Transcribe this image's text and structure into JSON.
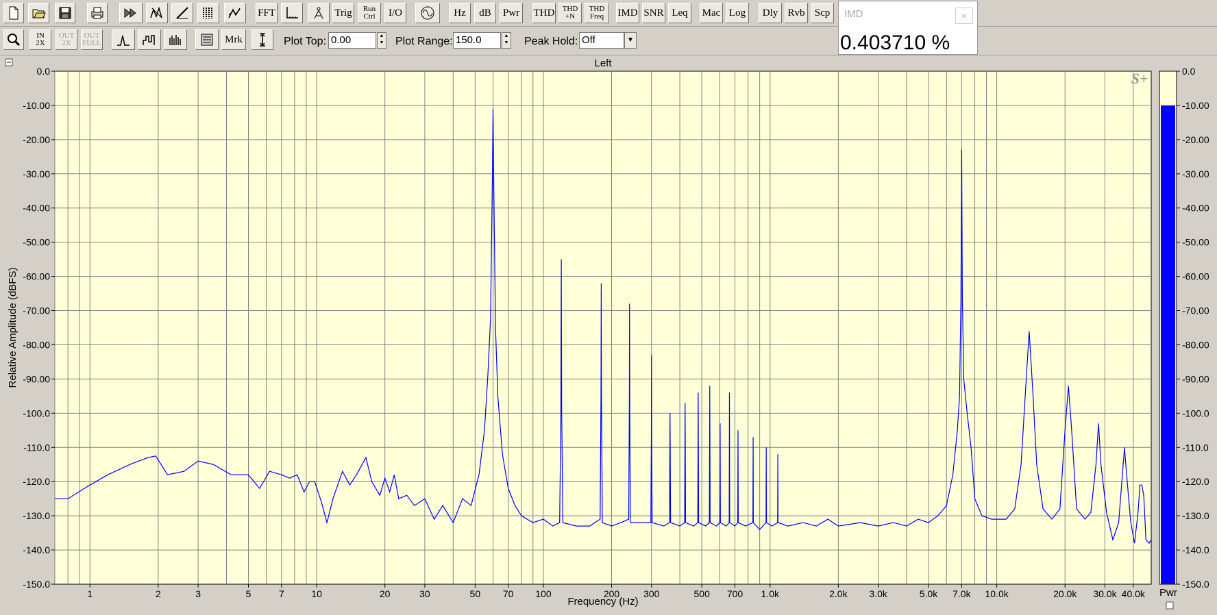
{
  "toolbar1": {
    "buttons": [
      {
        "name": "new-file-icon",
        "text": ""
      },
      {
        "name": "open-file-icon",
        "text": ""
      },
      {
        "name": "save-icon",
        "text": ""
      },
      {
        "name": "print-icon",
        "text": ""
      },
      {
        "name": "fast-forward-icon",
        "text": ""
      },
      {
        "name": "spectrum-settings-icon",
        "text": ""
      },
      {
        "name": "ramp-icon",
        "text": ""
      },
      {
        "name": "waterfall-icon",
        "text": ""
      },
      {
        "name": "3d-plot-icon",
        "text": ""
      },
      {
        "name": "fft-button",
        "text": "FFT"
      },
      {
        "name": "axis-button",
        "text": ""
      },
      {
        "name": "calibrate-icon",
        "text": ""
      },
      {
        "name": "trig-button",
        "text": "Trig"
      },
      {
        "name": "run-ctrl-button",
        "text": "Run\nCtrl"
      },
      {
        "name": "io-button",
        "text": "I/O"
      },
      {
        "name": "generator-icon",
        "text": ""
      },
      {
        "name": "hz-button",
        "text": "Hz"
      },
      {
        "name": "db-button",
        "text": "dB"
      },
      {
        "name": "pwr-button",
        "text": "Pwr"
      },
      {
        "name": "thd-button",
        "text": "THD"
      },
      {
        "name": "thd-n-button",
        "text": "THD\n+N"
      },
      {
        "name": "thd-freq-button",
        "text": "THD\nFreq"
      },
      {
        "name": "imd-button",
        "text": "IMD"
      },
      {
        "name": "snr-button",
        "text": "SNR"
      },
      {
        "name": "leq-button",
        "text": "Leq"
      },
      {
        "name": "mac-button",
        "text": "Mac"
      },
      {
        "name": "log-button",
        "text": "Log"
      },
      {
        "name": "dly-button",
        "text": "Dly"
      },
      {
        "name": "rvb-button",
        "text": "Rvb"
      },
      {
        "name": "scp-button",
        "text": "Scp"
      }
    ]
  },
  "toolbar2": {
    "buttons": [
      {
        "name": "zoom-icon",
        "text": ""
      },
      {
        "name": "zoom-in-2x-button",
        "text": "IN\n2X"
      },
      {
        "name": "zoom-out-2x-button",
        "text": "OUT\n2X"
      },
      {
        "name": "zoom-out-full-button",
        "text": "OUT\nFULL"
      },
      {
        "name": "line-plot-icon",
        "text": ""
      },
      {
        "name": "step-plot-icon",
        "text": ""
      },
      {
        "name": "bar-plot-icon",
        "text": ""
      },
      {
        "name": "settings-panel-icon",
        "text": ""
      },
      {
        "name": "marker-button",
        "text": "Mrk"
      },
      {
        "name": "range-icon",
        "text": ""
      }
    ],
    "plot_top_label": "Plot Top:",
    "plot_top_value": "0.00",
    "plot_range_label": "Plot Range:",
    "plot_range_value": "150.0",
    "peak_hold_label": "Peak Hold:",
    "peak_hold_value": "Off"
  },
  "imd_panel": {
    "title": "IMD",
    "value": "0.403710 %",
    "close": "×"
  },
  "pwr_label": "Pwr",
  "logo_text": "S+",
  "colors": {
    "plot_bg": "#ffffd8",
    "trace": "#0000ff",
    "grid": "#808080",
    "meter_fill": "#0000ff",
    "meter_bg": "#ffffd8"
  },
  "meter": {
    "level_db": -10
  },
  "chart_data": {
    "type": "line",
    "title": "Left",
    "xlabel": "Frequency (Hz)",
    "ylabel": "Relative Amplitude (dBFS)",
    "xscale": "log",
    "xlim": [
      0.7,
      48000
    ],
    "ylim": [
      -150,
      0
    ],
    "grid": true,
    "x_ticks": [
      1,
      2,
      3,
      5,
      7,
      10,
      20,
      30,
      50,
      70,
      100,
      200,
      300,
      500,
      700,
      1000,
      2000,
      3000,
      5000,
      7000,
      10000,
      20000,
      30000,
      40000
    ],
    "x_tick_labels": [
      "1",
      "2",
      "3",
      "5",
      "7",
      "10",
      "20",
      "30",
      "50",
      "70",
      "100",
      "200",
      "300",
      "500",
      "700",
      "1.0k",
      "2.0k",
      "3.0k",
      "5.0k",
      "7.0k",
      "10.0k",
      "20.0k",
      "30.0k",
      "40.0k"
    ],
    "y_ticks": [
      0,
      -10,
      -20,
      -30,
      -40,
      -50,
      -60,
      -70,
      -80,
      -90,
      -100,
      -110,
      -120,
      -130,
      -140,
      -150
    ],
    "y_tick_labels": [
      "0.0",
      "-10.00",
      "-20.00",
      "-30.00",
      "-40.00",
      "-50.00",
      "-60.00",
      "-70.00",
      "-80.00",
      "-90.00",
      "-100.0",
      "-110.0",
      "-120.0",
      "-130.0",
      "-140.0",
      "-150.0"
    ],
    "meter_tick_labels": [
      "0.0",
      "-10.00",
      "-20.00",
      "-30.00",
      "-40.00",
      "-50.00",
      "-60.00",
      "-70.00",
      "-80.00",
      "-90.00",
      "-100.0",
      "-110.0",
      "-120.0",
      "-130.0",
      "-140.0",
      "-150.0"
    ],
    "series": [
      {
        "values": [
          [
            0.7,
            -125
          ],
          [
            0.8,
            -125
          ],
          [
            1,
            -121
          ],
          [
            1.2,
            -118
          ],
          [
            1.5,
            -115
          ],
          [
            1.8,
            -113
          ],
          [
            1.95,
            -112.5
          ],
          [
            2.2,
            -118
          ],
          [
            2.6,
            -117
          ],
          [
            3,
            -114
          ],
          [
            3.5,
            -115
          ],
          [
            4.2,
            -118
          ],
          [
            5,
            -118
          ],
          [
            5.6,
            -122
          ],
          [
            6.2,
            -117
          ],
          [
            7,
            -118
          ],
          [
            7.6,
            -119
          ],
          [
            8.2,
            -118
          ],
          [
            8.8,
            -123
          ],
          [
            9.3,
            -120
          ],
          [
            9.8,
            -120
          ],
          [
            10.5,
            -126
          ],
          [
            11.1,
            -132
          ],
          [
            11.8,
            -125
          ],
          [
            13,
            -117
          ],
          [
            14,
            -121
          ],
          [
            15,
            -118
          ],
          [
            16.5,
            -113
          ],
          [
            17.5,
            -120
          ],
          [
            19,
            -124
          ],
          [
            20,
            -119
          ],
          [
            21,
            -123
          ],
          [
            22,
            -118
          ],
          [
            23,
            -125
          ],
          [
            25,
            -124
          ],
          [
            27,
            -127
          ],
          [
            30,
            -125
          ],
          [
            33,
            -131
          ],
          [
            36,
            -127
          ],
          [
            40,
            -132
          ],
          [
            44,
            -125
          ],
          [
            48,
            -127
          ],
          [
            52,
            -118
          ],
          [
            55,
            -105
          ],
          [
            57,
            -88
          ],
          [
            58.5,
            -72
          ],
          [
            59.5,
            -35
          ],
          [
            60,
            -11
          ],
          [
            60.5,
            -35
          ],
          [
            61.5,
            -75
          ],
          [
            63,
            -95
          ],
          [
            66,
            -112
          ],
          [
            70,
            -122
          ],
          [
            75,
            -127
          ],
          [
            80,
            -130
          ],
          [
            90,
            -132
          ],
          [
            100,
            -131
          ],
          [
            110,
            -133
          ],
          [
            118,
            -132
          ],
          [
            119.5,
            -100
          ],
          [
            120,
            -55
          ],
          [
            120.5,
            -100
          ],
          [
            122,
            -132
          ],
          [
            140,
            -133
          ],
          [
            160,
            -133
          ],
          [
            178,
            -131
          ],
          [
            179.5,
            -95
          ],
          [
            180,
            -62
          ],
          [
            180.5,
            -95
          ],
          [
            182,
            -132
          ],
          [
            200,
            -133
          ],
          [
            220,
            -132
          ],
          [
            238,
            -131
          ],
          [
            239.5,
            -98
          ],
          [
            240,
            -68
          ],
          [
            240.5,
            -98
          ],
          [
            242,
            -132
          ],
          [
            270,
            -132
          ],
          [
            298,
            -132
          ],
          [
            299.5,
            -108
          ],
          [
            300,
            -83
          ],
          [
            300.5,
            -108
          ],
          [
            302,
            -132
          ],
          [
            340,
            -133
          ],
          [
            360,
            -132
          ],
          [
            362,
            -100
          ],
          [
            364,
            -132
          ],
          [
            400,
            -133
          ],
          [
            420,
            -132
          ],
          [
            422,
            -97
          ],
          [
            424,
            -132
          ],
          [
            460,
            -133
          ],
          [
            480,
            -132
          ],
          [
            482,
            -94
          ],
          [
            484,
            -132
          ],
          [
            520,
            -133
          ],
          [
            540,
            -132
          ],
          [
            542,
            -92
          ],
          [
            544,
            -132
          ],
          [
            580,
            -133
          ],
          [
            600,
            -132
          ],
          [
            602,
            -103
          ],
          [
            604,
            -132
          ],
          [
            640,
            -133
          ],
          [
            660,
            -132
          ],
          [
            662,
            -94
          ],
          [
            664,
            -132
          ],
          [
            700,
            -133
          ],
          [
            720,
            -132
          ],
          [
            722,
            -105
          ],
          [
            724,
            -132
          ],
          [
            780,
            -133
          ],
          [
            840,
            -132
          ],
          [
            842,
            -107
          ],
          [
            844,
            -132
          ],
          [
            900,
            -134
          ],
          [
            960,
            -132
          ],
          [
            962,
            -110
          ],
          [
            964,
            -132
          ],
          [
            1020,
            -133
          ],
          [
            1080,
            -132
          ],
          [
            1082,
            -112
          ],
          [
            1084,
            -132
          ],
          [
            1200,
            -133
          ],
          [
            1400,
            -132
          ],
          [
            1600,
            -133
          ],
          [
            1800,
            -131
          ],
          [
            2000,
            -133
          ],
          [
            2500,
            -132
          ],
          [
            3000,
            -133
          ],
          [
            3500,
            -132
          ],
          [
            4000,
            -133
          ],
          [
            4500,
            -131
          ],
          [
            5000,
            -132
          ],
          [
            5500,
            -130
          ],
          [
            6000,
            -127
          ],
          [
            6400,
            -118
          ],
          [
            6700,
            -105
          ],
          [
            6850,
            -95
          ],
          [
            6950,
            -66
          ],
          [
            7000,
            -23
          ],
          [
            7050,
            -66
          ],
          [
            7150,
            -90
          ],
          [
            7400,
            -100
          ],
          [
            7700,
            -110
          ],
          [
            8000,
            -125
          ],
          [
            8600,
            -130
          ],
          [
            9500,
            -131
          ],
          [
            11000,
            -131
          ],
          [
            12000,
            -128
          ],
          [
            12800,
            -115
          ],
          [
            13400,
            -93
          ],
          [
            13900,
            -76
          ],
          [
            14400,
            -93
          ],
          [
            15000,
            -115
          ],
          [
            16000,
            -128
          ],
          [
            17500,
            -131
          ],
          [
            19000,
            -128
          ],
          [
            20000,
            -105
          ],
          [
            20700,
            -92
          ],
          [
            21400,
            -105
          ],
          [
            22500,
            -128
          ],
          [
            24500,
            -131
          ],
          [
            26000,
            -129
          ],
          [
            27400,
            -115
          ],
          [
            28100,
            -103
          ],
          [
            28800,
            -115
          ],
          [
            30500,
            -129
          ],
          [
            32500,
            -137
          ],
          [
            34500,
            -132
          ],
          [
            35800,
            -118
          ],
          [
            36600,
            -110
          ],
          [
            37400,
            -118
          ],
          [
            39000,
            -132
          ],
          [
            40500,
            -138
          ],
          [
            42000,
            -129
          ],
          [
            42800,
            -121
          ],
          [
            43600,
            -121
          ],
          [
            44500,
            -124
          ],
          [
            45500,
            -137
          ],
          [
            47000,
            -138
          ],
          [
            48000,
            -137
          ]
        ]
      }
    ]
  }
}
